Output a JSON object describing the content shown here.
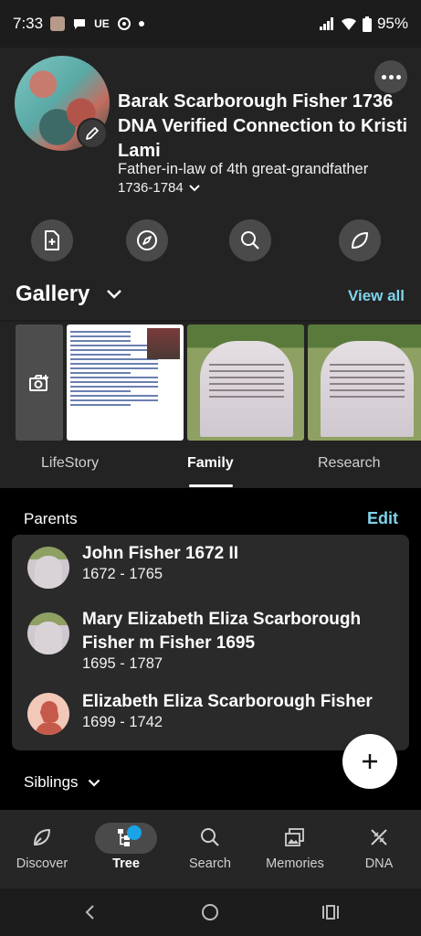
{
  "status_bar": {
    "time": "7:33",
    "carrier_tag": "UE",
    "battery": "95%"
  },
  "header": {
    "person_name": "Barak Scarborough Fisher 1736 DNA Verified Connection to Kristi Lami",
    "relationship": "Father-in-law of 4th great-grandfather",
    "lifespan": "1736-1784"
  },
  "gallery": {
    "title": "Gallery",
    "view_all": "View all"
  },
  "tabs": [
    "LifeStory",
    "Family",
    "Research"
  ],
  "active_tab": "Family",
  "family": {
    "parents_label": "Parents",
    "edit_label": "Edit",
    "parents": [
      {
        "name": "John Fisher 1672 II",
        "dates": "1672 - 1765"
      },
      {
        "name": "Mary Elizabeth Eliza Scarborough Fisher m Fisher 1695",
        "dates": "1695 - 1787"
      },
      {
        "name": "Elizabeth Eliza Scarborough Fisher",
        "dates": "1699 - 1742"
      }
    ],
    "siblings_label": "Siblings"
  },
  "bottom_nav": [
    {
      "label": "Discover",
      "icon": "leaf-icon"
    },
    {
      "label": "Tree",
      "icon": "tree-icon"
    },
    {
      "label": "Search",
      "icon": "search-icon"
    },
    {
      "label": "Memories",
      "icon": "photos-icon"
    },
    {
      "label": "DNA",
      "icon": "dna-icon"
    }
  ],
  "active_nav": "Tree",
  "colors": {
    "accent": "#7fd3ea",
    "badge": "#1aa3e6",
    "background": "#1c1c1c"
  }
}
